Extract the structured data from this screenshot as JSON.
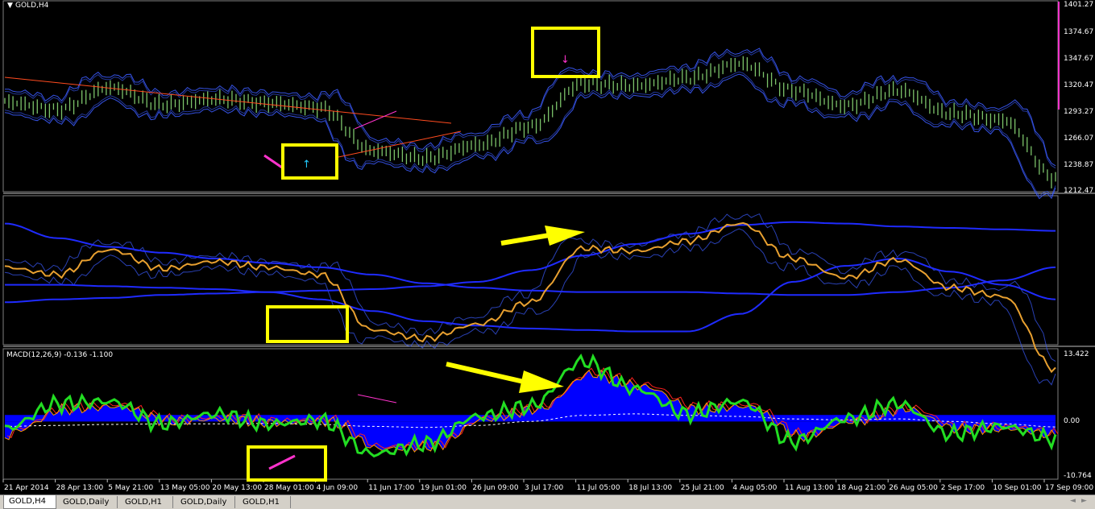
{
  "window": {
    "title": "GOLD,H4",
    "tabs": [
      "GOLD,H4",
      "GOLD,Daily",
      "GOLD,H1",
      "GOLD,Daily",
      "GOLD,H1"
    ],
    "active_tab": 0
  },
  "colors": {
    "background": "#000000",
    "price_candles": "#7cc36a",
    "bands": "#3b5bff",
    "trendline": "#ff4b1f",
    "close_line": "#e8a030",
    "ma_slow": "#1f2bff",
    "macd_hist": "#0000ff",
    "macd_line": "#22dd22",
    "signal_line": "#ff2020",
    "highlight_box": "#ffff00",
    "arrow": "#ffff00",
    "marker": "#ff33cc"
  },
  "icons": [
    "pane-menu-icon",
    "tab-scroll-left-icon",
    "tab-scroll-right-icon",
    "buy-arrow-icon",
    "sell-arrow-icon"
  ],
  "chart_data": [
    {
      "type": "line",
      "pane": "price",
      "title": "GOLD,H4",
      "y_ticks": [
        "1401.27",
        "1374.67",
        "1347.67",
        "1320.47",
        "1293.27",
        "1266.07",
        "1238.87",
        "1212.47"
      ],
      "ylim": [
        1207,
        1405
      ],
      "x": [
        0,
        5,
        10,
        15,
        20,
        25,
        30,
        35,
        40,
        45,
        50,
        55,
        60,
        65,
        70,
        75,
        80,
        85,
        90,
        95,
        100
      ],
      "series": [
        {
          "values": [
            1300,
            1292,
            1315,
            1297,
            1303,
            1299,
            1294,
            1249,
            1241,
            1255,
            1274,
            1319,
            1317,
            1325,
            1340,
            1312,
            1296,
            1312,
            1288,
            1281,
            1220
          ]
        }
      ]
    },
    {
      "type": "line",
      "pane": "indicator",
      "ylim": [
        0,
        100
      ],
      "x": [
        0,
        5,
        10,
        15,
        20,
        25,
        30,
        35,
        40,
        45,
        50,
        55,
        60,
        65,
        70,
        75,
        80,
        85,
        90,
        95,
        100
      ],
      "series": [
        {
          "values": [
            52,
            47,
            64,
            51,
            56,
            52,
            47,
            9,
            3,
            13,
            28,
            65,
            63,
            70,
            82,
            58,
            45,
            57,
            38,
            32,
            -18
          ]
        },
        {
          "values": [
            82,
            72,
            66,
            62,
            58,
            55,
            52,
            47,
            41,
            38,
            36,
            35,
            35,
            35,
            34,
            33,
            33,
            35,
            38,
            43,
            52
          ]
        },
        {
          "values": [
            28,
            30,
            31,
            33,
            34,
            35,
            36,
            37,
            39,
            42,
            50,
            60,
            68,
            75,
            81,
            83,
            82,
            80,
            79,
            78,
            77
          ]
        },
        {
          "values": [
            40,
            40,
            39,
            38,
            37,
            35,
            30,
            22,
            15,
            12,
            10,
            9,
            8,
            8,
            20,
            42,
            53,
            58,
            49,
            40,
            30
          ]
        }
      ]
    },
    {
      "type": "area",
      "pane": "macd",
      "title": "MACD(12,26,9) -0.136 -1.100",
      "y_ticks": [
        "13.422",
        "0.00",
        "-10.764"
      ],
      "ylim": [
        -10.764,
        13.422
      ],
      "x": [
        0,
        5,
        10,
        15,
        20,
        25,
        30,
        35,
        40,
        45,
        50,
        55,
        60,
        65,
        70,
        75,
        80,
        85,
        90,
        95,
        100
      ],
      "series": [
        {
          "values": [
            -1.5,
            3.5,
            4.0,
            -0.5,
            1.5,
            -0.5,
            0.2,
            -6.5,
            -4.5,
            1.0,
            3.0,
            12.0,
            6.5,
            1.5,
            4.0,
            -4.0,
            0.5,
            3.5,
            -2.5,
            -1.0,
            -3.5
          ]
        },
        {
          "values": [
            -2.0,
            2.5,
            3.0,
            0.0,
            0.5,
            -0.3,
            0.0,
            -5.5,
            -5.0,
            0.5,
            2.5,
            9.5,
            7.0,
            2.5,
            3.0,
            -3.0,
            0.0,
            2.5,
            -1.5,
            -1.5,
            -3.0
          ]
        },
        {
          "values": [
            -1.0,
            -0.8,
            -0.6,
            -0.5,
            -0.5,
            -0.4,
            -0.6,
            -1.0,
            -1.2,
            -0.8,
            0.0,
            1.2,
            1.5,
            1.2,
            1.0,
            0.5,
            0.3,
            0.5,
            0.0,
            -0.5,
            -1.1
          ]
        }
      ]
    }
  ],
  "time_axis": [
    "21 Apr 2014",
    "28 Apr 13:00",
    "5 May 21:00",
    "13 May 05:00",
    "20 May 13:00",
    "28 May 01:00",
    "4 Jun 09:00",
    "11 Jun 17:00",
    "19 Jun 01:00",
    "26 Jun 09:00",
    "3 Jul 17:00",
    "11 Jul 05:00",
    "18 Jul 13:00",
    "25 Jul 21:00",
    "4 Aug 05:00",
    "11 Aug 13:00",
    "18 Aug 21:00",
    "26 Aug 05:00",
    "2 Sep 17:00",
    "10 Sep 01:00",
    "17 Sep 09:00"
  ]
}
